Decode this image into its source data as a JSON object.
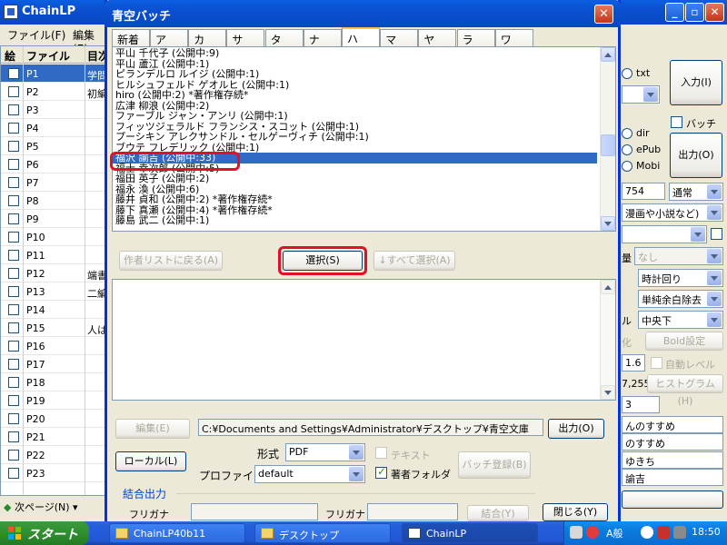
{
  "main_window": {
    "title": "ChainLP",
    "menu": [
      "ファイル(F)",
      "編集(E)"
    ],
    "table": {
      "headers": [
        "絵",
        "ファイル",
        "目次"
      ],
      "rows": [
        {
          "file": "P1",
          "title": "学問"
        },
        {
          "file": "P2",
          "title": "初編"
        },
        {
          "file": "P3",
          "title": ""
        },
        {
          "file": "P4",
          "title": ""
        },
        {
          "file": "P5",
          "title": ""
        },
        {
          "file": "P6",
          "title": ""
        },
        {
          "file": "P7",
          "title": ""
        },
        {
          "file": "P8",
          "title": ""
        },
        {
          "file": "P9",
          "title": ""
        },
        {
          "file": "P10",
          "title": ""
        },
        {
          "file": "P11",
          "title": ""
        },
        {
          "file": "P12",
          "title": "端書"
        },
        {
          "file": "P13",
          "title": "二編"
        },
        {
          "file": "P14",
          "title": ""
        },
        {
          "file": "P15",
          "title": "人は"
        },
        {
          "file": "P16",
          "title": ""
        },
        {
          "file": "P17",
          "title": ""
        },
        {
          "file": "P18",
          "title": ""
        },
        {
          "file": "P19",
          "title": ""
        },
        {
          "file": "P20",
          "title": ""
        },
        {
          "file": "P21",
          "title": ""
        },
        {
          "file": "P22",
          "title": ""
        },
        {
          "file": "P23",
          "title": ""
        }
      ]
    },
    "next_page": "次ページ(N)",
    "right": {
      "txt": "txt",
      "input_btn": "入力(I)",
      "batch": "バッチ",
      "dir": "dir",
      "epub": "ePub",
      "mobi": "Mobi",
      "output_btn": "出力(O)",
      "size_value": "754",
      "mode": "通常",
      "genre": "漫画や小説など)",
      "margin_label": "量",
      "margin_value": "なし",
      "rotation": "時計回り",
      "trim": "単純余白除去",
      "center_label": "ル",
      "center": "中央下",
      "bold_label": "化",
      "bold_btn": "Bold設定",
      "level_value": "1.6",
      "auto_level": "自動レベル",
      "hist_value": "7,255",
      "hist_btn": "ヒストグラム(H)",
      "small_value": "3",
      "title_1": "んのすすめ",
      "title_2": "のすすめ",
      "author_1": "ゆきち",
      "author_2": "諭吉"
    }
  },
  "dialog": {
    "title": "青空バッチ",
    "tabs": [
      "新着",
      "ア",
      "カ",
      "サ",
      "タ",
      "ナ",
      "ハ",
      "マ",
      "ヤ",
      "ラ",
      "ワ"
    ],
    "active_tab": "ハ",
    "authors": [
      "平山 千代子 (公開中:9)",
      "平山 蘆江 (公開中:1)",
      "ピランデルロ ルイジ (公開中:1)",
      "ヒルシュフェルド ゲオルヒ (公開中:1)",
      "hiro (公開中:2)  *著作権存続*",
      "広津 柳浪 (公開中:2)",
      "ファーブル ジャン・アンリ (公開中:1)",
      "フィッツジェラルド フランシス・スコット (公開中:1)",
      "プーシキン アレクサンドル・セルゲーヴィチ (公開中:1)",
      "ブウテ フレデリック (公開中:1)",
      "福沢 諭吉 (公開中:33)",
      "福士 幸次郎 (公開中:5)",
      "福田 英子 (公開中:2)",
      "福永 渙 (公開中:6)",
      "藤井 貞和 (公開中:2)  *著作権存続*",
      "藤下 真瀬 (公開中:4)  *著作権存続*",
      "藤島 武二 (公開中:1)"
    ],
    "selected_author": "福沢 諭吉 (公開中:33)",
    "back_btn": "作者リストに戻る(A)",
    "select_btn": "選択(S)",
    "select_all_btn": "↓すべて選択(A)",
    "edit_btn": "編集(E)",
    "path": "C:¥Documents and Settings¥Administrator¥デスクトップ¥青空文庫",
    "output_btn": "出力(O)",
    "local_btn": "ローカル(L)",
    "format_label": "形式",
    "format": "PDF",
    "text_label": "テキスト",
    "author_folder_label": "著者フォルダ",
    "batch_register_btn": "バッチ登録(B)",
    "profile_label": "プロファイル",
    "profile": "default",
    "combine_output": "結合出力",
    "furigana_1": "フリガナ",
    "furigana_2": "フリガナ",
    "combine_btn": "結合(Y)",
    "close_btn": "閉じる(Y)"
  },
  "taskbar": {
    "start": "スタート",
    "tasks": [
      "ChainLP40b11",
      "デスクトップ",
      "ChainLP"
    ],
    "ime": "A般",
    "clock": "18:50"
  }
}
